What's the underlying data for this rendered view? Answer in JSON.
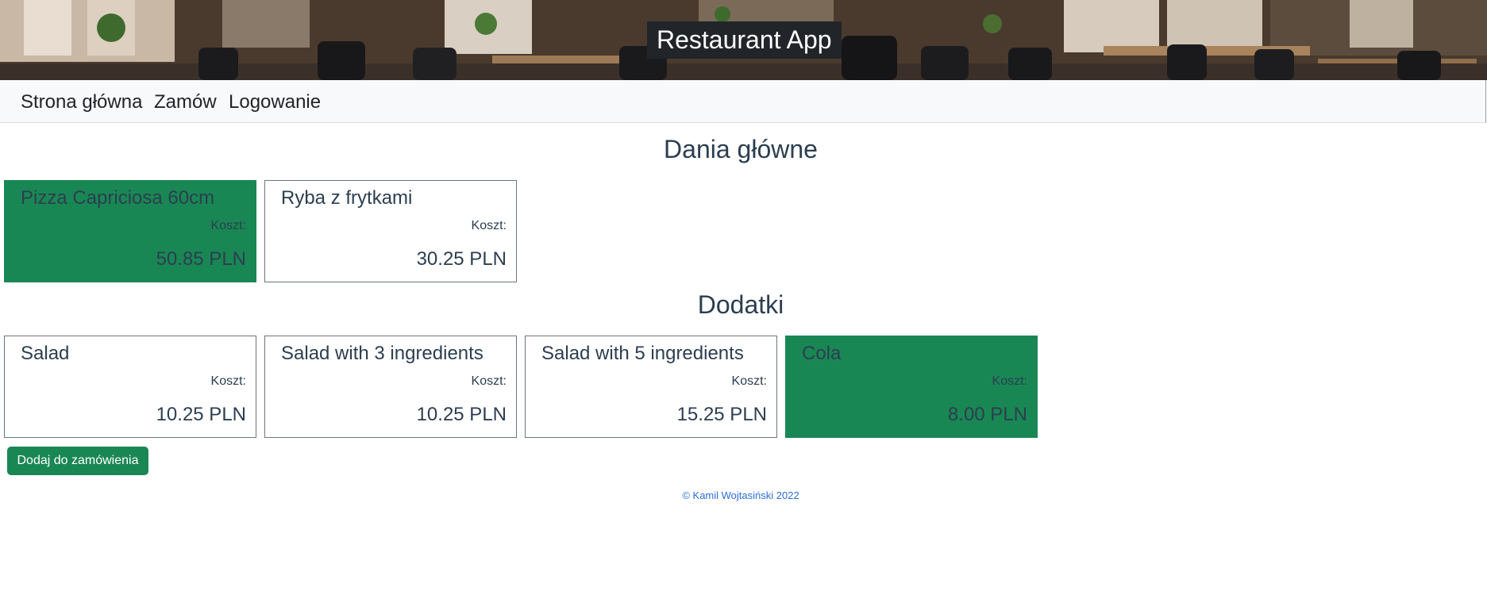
{
  "header": {
    "title": "Restaurant App"
  },
  "nav": {
    "items": [
      {
        "label": "Strona główna"
      },
      {
        "label": "Zamów"
      },
      {
        "label": "Logowanie"
      }
    ]
  },
  "sections": [
    {
      "title": "Dania główne",
      "items": [
        {
          "name": "Pizza Capriciosa 60cm",
          "cost_label": "Koszt:",
          "price": "50.85 PLN",
          "selected": true
        },
        {
          "name": "Ryba z frytkami",
          "cost_label": "Koszt:",
          "price": "30.25 PLN",
          "selected": false
        }
      ]
    },
    {
      "title": "Dodatki",
      "items": [
        {
          "name": "Salad",
          "cost_label": "Koszt:",
          "price": "10.25 PLN",
          "selected": false
        },
        {
          "name": "Salad with 3 ingredients",
          "cost_label": "Koszt:",
          "price": "10.25 PLN",
          "selected": false
        },
        {
          "name": "Salad with 5 ingredients",
          "cost_label": "Koszt:",
          "price": "15.25 PLN",
          "selected": false
        },
        {
          "name": "Cola",
          "cost_label": "Koszt:",
          "price": "8.00 PLN",
          "selected": true
        }
      ]
    }
  ],
  "actions": {
    "add_label": "Dodaj do zamówienia"
  },
  "footer": {
    "text": "© Kamil Wojtasiński 2022"
  },
  "colors": {
    "selected": "#198754",
    "title_bg": "#212529",
    "navbar_bg": "#f8f9fa",
    "footer_text": "#2b6fdc"
  }
}
